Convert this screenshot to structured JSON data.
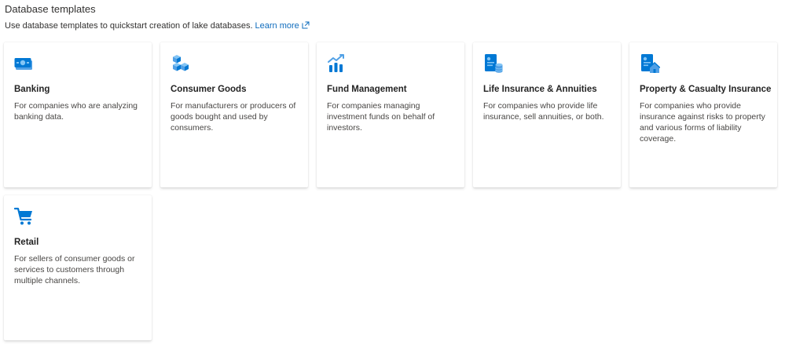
{
  "header": {
    "title": "Database templates",
    "subtitle": "Use database templates to quickstart creation of lake databases.",
    "learn_more": "Learn more"
  },
  "templates": [
    {
      "title": "Banking",
      "description": "For companies who are analyzing banking data.",
      "icon": "banking-icon"
    },
    {
      "title": "Consumer Goods",
      "description": "For manufacturers or producers of goods bought and used by consumers.",
      "icon": "consumer-goods-icon"
    },
    {
      "title": "Fund Management",
      "description": "For companies managing investment funds on behalf of investors.",
      "icon": "fund-management-icon"
    },
    {
      "title": "Life Insurance & Annuities",
      "description": "For companies who provide life insurance, sell annuities, or both.",
      "icon": "life-insurance-icon"
    },
    {
      "title": "Property & Casualty Insurance",
      "description": "For companies who provide insurance against risks to property and various forms of liability coverage.",
      "icon": "property-insurance-icon"
    },
    {
      "title": "Retail",
      "description": "For sellers of consumer goods or services to customers through multiple channels.",
      "icon": "retail-icon"
    }
  ],
  "colors": {
    "link": "#0f6cbd",
    "icon_primary": "#0078d4",
    "icon_light": "#50a0e6",
    "icon_accent": "#83c5f5"
  }
}
